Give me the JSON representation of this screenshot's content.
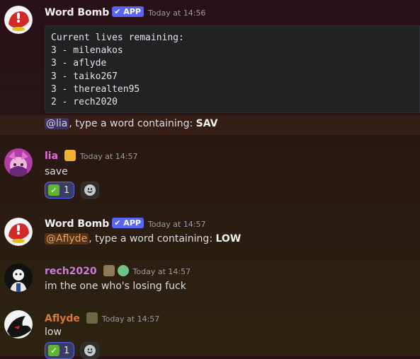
{
  "messages": {
    "m1": {
      "author": "Word Bomb",
      "app_tag": "✔ APP",
      "time": "Today at 14:56",
      "code_block": "Current lives remaining:\n3 - milenakos\n3 - aflyde\n3 - taiko267\n3 - therealten95\n2 - rech2020",
      "mention": "@lia",
      "prompt_text": ", type a word containing: ",
      "prompt_sub": "SAV"
    },
    "m2": {
      "author": "lia",
      "time": "Today at 14:57",
      "text": "save",
      "reaction_count": "1"
    },
    "m3": {
      "author": "Word Bomb",
      "app_tag": "✔ APP",
      "time": "Today at 14:57",
      "mention": "@Aflyde",
      "prompt_text": ", type a word containing: ",
      "prompt_sub": "LOW"
    },
    "m4": {
      "author": "rech2020",
      "time": "Today at 14:57",
      "text": "im the one who's losing fuck"
    },
    "m5": {
      "author": "Aflyde",
      "time": "Today at 14:57",
      "text": "low",
      "reaction_count": "1"
    }
  },
  "colors": {
    "lia_name": "#e86ce0",
    "rech_name": "#c77ed6",
    "aflyde_name": "#d9782f",
    "bot_name": "#f2f3f5"
  }
}
